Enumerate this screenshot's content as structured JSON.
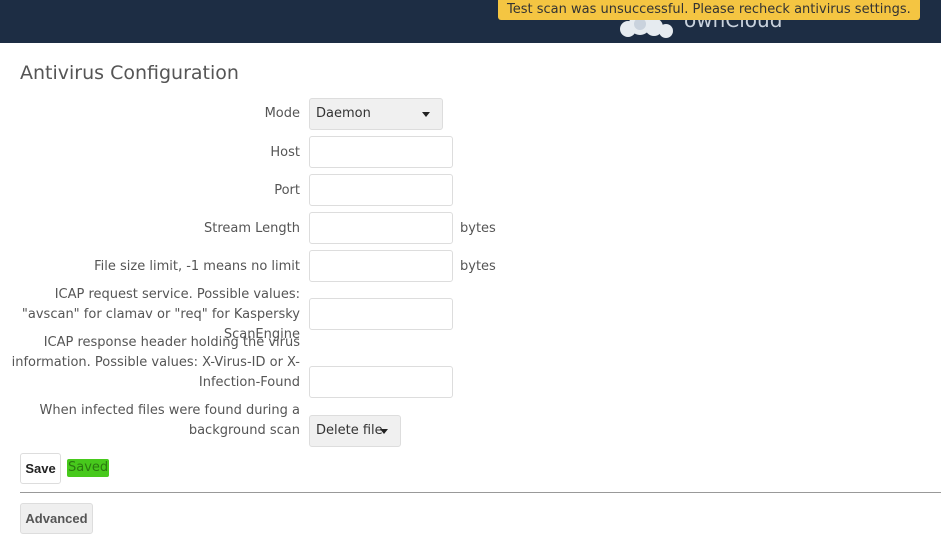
{
  "header": {
    "logo_text": "ownCloud",
    "background_color": "#1d2d44"
  },
  "notification": {
    "text": "Test scan was unsuccessful. Please recheck antivirus settings.",
    "color": "#f4c542"
  },
  "section": {
    "title": "Antivirus Configuration"
  },
  "form": {
    "mode": {
      "label": "Mode",
      "value": "Daemon"
    },
    "host": {
      "label": "Host",
      "value": ""
    },
    "port": {
      "label": "Port",
      "value": ""
    },
    "stream_length": {
      "label": "Stream Length",
      "value": "",
      "unit": "bytes"
    },
    "file_size_limit": {
      "label": "File size limit, -1 means no limit",
      "value": "",
      "unit": "bytes"
    },
    "icap_request_service": {
      "label": "ICAP request service. Possible values: \"avscan\" for clamav or \"req\" for Kaspersky ScanEngine",
      "value": ""
    },
    "icap_response_header": {
      "label": "ICAP response header holding the virus information. Possible values: X-Virus-ID or X-Infection-Found",
      "value": ""
    },
    "infected_action": {
      "label": "When infected files were found during a background scan",
      "value": "Delete file"
    }
  },
  "actions": {
    "save_label": "Save",
    "saved_label": "Saved",
    "saved_color": "#47c91c",
    "advanced_label": "Advanced"
  }
}
